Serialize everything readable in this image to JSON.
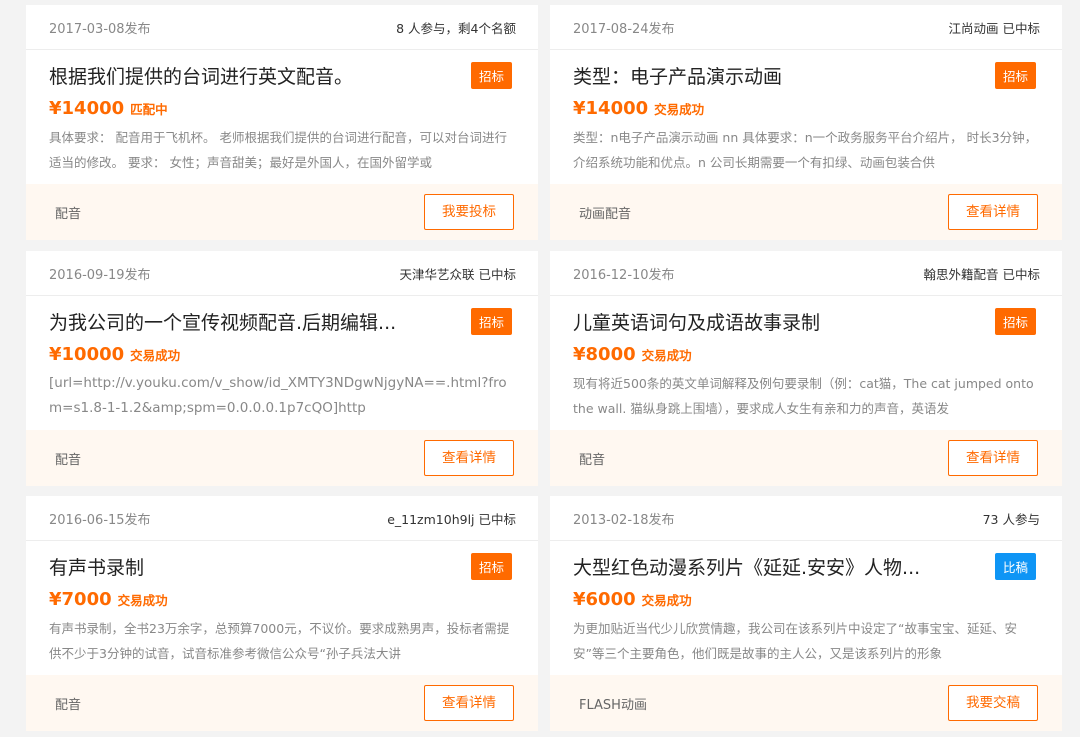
{
  "cards": [
    {
      "date": "2017-03-08发布",
      "meta": "8 人参与，剩4个名额",
      "title": "根据我们提供的台词进行英文配音。",
      "badge": "招标",
      "price": "¥14000",
      "status": "匹配中",
      "desc": "具体要求： 配音用于飞机杯。 老师根据我们提供的台词进行配音，可以对台词进行适当的修改。 要求： 女性；声音甜美；最好是外国人，在国外留学或",
      "tag": "配音",
      "button": "我要投标"
    },
    {
      "date": "2017-08-24发布",
      "meta": "江尚动画 已中标",
      "title": "类型：电子产品演示动画",
      "badge": "招标",
      "price": "¥14000",
      "status": "交易成功",
      "desc": "类型：n电子产品演示动画 nn 具体要求：n一个政务服务平台介绍片， 时长3分钟，介绍系统功能和优点。n 公司长期需要一个有扣绿、动画包装合供",
      "tag": "动画配音",
      "button": "查看详情"
    },
    {
      "date": "2016-09-19发布",
      "meta": "天津华艺众联 已中标",
      "title": "为我公司的一个宣传视频配音.后期编辑...",
      "badge": "招标",
      "price": "¥10000",
      "status": "交易成功",
      "desc": "[url=http://v.youku.com/v_show/id_XMTY3NDgwNjgyNA==.html?from=s1.8-1-1.2&amp;spm=0.0.0.0.1p7cQO]http",
      "tag": "配音",
      "button": "查看详情"
    },
    {
      "date": "2016-12-10发布",
      "meta": "翰思外籍配音 已中标",
      "title": "儿童英语词句及成语故事录制",
      "badge": "招标",
      "price": "¥8000",
      "status": "交易成功",
      "desc": "现有将近500条的英文单词解释及例句要录制（例：cat猫，The cat jumped onto the wall. 猫纵身跳上围墙），要求成人女生有亲和力的声音，英语发",
      "tag": "配音",
      "button": "查看详情"
    },
    {
      "date": "2016-06-15发布",
      "meta": "e_11zm10h9lj 已中标",
      "title": "有声书录制",
      "badge": "招标",
      "price": "¥7000",
      "status": "交易成功",
      "desc": "有声书录制，全书23万余字，总预算7000元，不议价。要求成熟男声，投标者需提供不少于3分钟的试音，试音标准参考微信公众号“孙子兵法大讲",
      "tag": "配音",
      "button": "查看详情"
    },
    {
      "date": "2013-02-18发布",
      "meta": "73 人参与",
      "title": "大型红色动漫系列片《延延.安安》人物...",
      "badge": "比稿",
      "price": "¥6000",
      "status": "交易成功",
      "desc": "为更加贴近当代少儿欣赏情趣，我公司在该系列片中设定了“故事宝宝、延延、安安”等三个主要角色，他们既是故事的主人公，又是该系列片的形象",
      "tag": "FLASH动画",
      "button": "我要交稿"
    }
  ],
  "colors": {
    "accent": "#ff6a00",
    "blue_badge": "#0e95f5",
    "footer_bg": "#fff8f1",
    "page_bg": "#f3f3f3"
  }
}
